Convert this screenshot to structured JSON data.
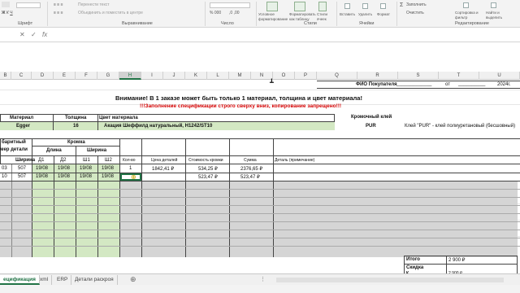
{
  "ribbon": {
    "font_group": "Шрифт",
    "align_group": "Выравнивание",
    "number_group": "Число",
    "styles_group": "Стили",
    "cells_group": "Ячейки",
    "edit_group": "Редактирование",
    "wrap_text": "Перенести текст",
    "merge_center": "Объединить и поместить в центре",
    "currency_glyph": "% 000",
    "decimal_glyphs": ",0 ,00",
    "cond_format": "Условное форматирование",
    "table_format": "Форматировать как таблицу",
    "cell_styles": "Стили ячеек",
    "insert": "Вставить",
    "delete": "Удалить",
    "format": "Формат",
    "autosum": "Σ",
    "fill": "Заполнить",
    "clear": "Очистить",
    "sort_filter": "Сортировка и фильтр",
    "find_select": "Найти и выделить"
  },
  "formula_bar": {
    "cancel": "✕",
    "confirm": "✓",
    "fx": "fx",
    "value": ""
  },
  "columns": [
    "B",
    "C",
    "D",
    "E",
    "F",
    "G",
    "H",
    "I",
    "J",
    "K",
    "L",
    "M",
    "N",
    "O",
    "P",
    "Q",
    "R",
    "S",
    "T",
    "U"
  ],
  "active_column": "H",
  "sheet": {
    "buyer_label": "ФИО Покупателя",
    "buyer_line": "_____________",
    "from_label": "от",
    "date_line": "__________",
    "year_suffix": "2024г.",
    "warning_title": "Внимание! В 1 заказе может быть только 1 материал, толщина и цвет материала!",
    "warning_sub": "!!!Заполнение спецификации строго сверху вниз, копирование запрещено!!!",
    "material_hdr": "Материал",
    "thickness_hdr": "Толщина",
    "color_hdr": "Цвет материала",
    "material_val": "Egger",
    "thickness_val": "16",
    "color_val": "Акация Шеффилд натуральный, H1242/ST10",
    "edge_glue_label": "Кромочный клей",
    "edge_glue_val": "PUR",
    "edge_glue_desc": "Клей \"PUR\" - клей полиуретановый (бесшовный)",
    "size_hdr_1": "баритный",
    "size_hdr_2": "мер детали",
    "width_hdr": "Ширина",
    "edge_hdr": "Кромка",
    "length_hdr": "Длина",
    "edge_width_hdr": "Ширина",
    "d1": "Д1",
    "d2": "Д2",
    "sh1": "Ш1",
    "sh2": "Ш2",
    "qty_hdr": "Кол-во",
    "price_hdr": "Цена деталей",
    "edge_cost_hdr": "Стоимость кромки",
    "sum_hdr": "Сумма",
    "note_hdr": "Деталь (примечание)"
  },
  "rows": [
    {
      "a": "03",
      "w": "507",
      "d1": "19/08",
      "d2": "19/08",
      "sh1": "19/08",
      "sh2": "19/08",
      "qty": "1",
      "price": "1842,41 ₽",
      "edge": "534,25 ₽",
      "sum": "2376,65 ₽"
    },
    {
      "a": "10",
      "w": "507",
      "d1": "19/08",
      "d2": "19/08",
      "sh1": "19/08",
      "sh2": "19/08",
      "qty": "",
      "price": "",
      "edge": "523,47 ₽",
      "sum": "523,47 ₽"
    }
  ],
  "totals": {
    "total_label": "Итого",
    "total_val": "2 900 ₽",
    "discount_label": "Скидка",
    "third_label": "К",
    "third_val": "2 900 ₽"
  },
  "tabs": [
    "ецификация",
    "xml",
    "ERP",
    "Детали раскроя"
  ],
  "colors": {
    "green_fill": "#d3e8c3",
    "gray_fill": "#d5d5d5",
    "accent": "#217346",
    "warning_red": "#d40000"
  }
}
